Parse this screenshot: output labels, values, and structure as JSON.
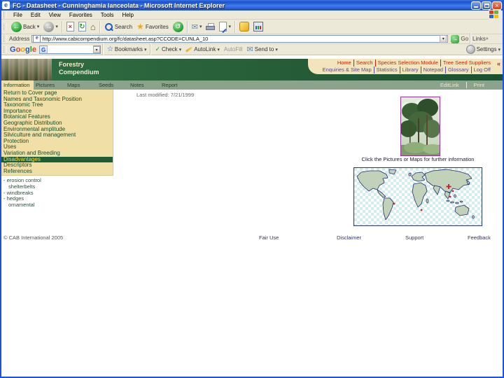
{
  "window": {
    "title": "FC - Datasheet - Cunninghamia lanceolata - Microsoft Internet Explorer"
  },
  "menu": {
    "items": [
      "File",
      "Edit",
      "View",
      "Favorites",
      "Tools",
      "Help"
    ]
  },
  "toolbar": {
    "back": "Back",
    "search": "Search",
    "favorites": "Favorites"
  },
  "address": {
    "label": "Address",
    "url": "http://www.cabicompendium.org/fc/datasheet.asp?CCODE=CUNLA_10",
    "go": "Go",
    "links": "Links"
  },
  "google": {
    "letters": [
      "G",
      "o",
      "o",
      "g",
      "l",
      "e"
    ],
    "search_value": "",
    "bookmarks": "Bookmarks",
    "check": "Check",
    "autolink": "AutoLink",
    "autofill": "AutoFill",
    "sendto": "Send to",
    "settings": "Settings"
  },
  "header": {
    "title1": "Forestry",
    "title2": "Compendium",
    "nav1": [
      "Home",
      "Search",
      "Species Selection Module",
      "Tree Seed Suppliers"
    ],
    "nav2": [
      "Enquiries & Site Map",
      "Statistics",
      "Library",
      "Notepad",
      "Glossary",
      "Log Off"
    ]
  },
  "tabs": {
    "items": [
      "Information",
      "Pictures",
      "Maps",
      "Seeds",
      "Notes",
      "Report"
    ],
    "active": "Information",
    "right1": "EditLink",
    "right2": "Print"
  },
  "sidebar": {
    "items": [
      "Return to Cover page",
      "Names and Taxonomic Position",
      "Taxonomic Tree",
      "Importance",
      "Botanical Features",
      "Geographic Distribution",
      "Environmental amplitude",
      "Silviculture and management",
      "Protection",
      "Uses",
      "Variation and Breeding",
      "Disadvantages",
      "Descriptors",
      "References"
    ],
    "active": "Disadvantages",
    "sub": [
      "- erosion control",
      "shelterbelts",
      "- windbreaks",
      "- hedges",
      "ornamental"
    ]
  },
  "content": {
    "last_modified": "Last modified: 7/21/1999",
    "caption": "Click the Pictures or Maps for further information"
  },
  "footer": {
    "copyright": "© CAB International 2005",
    "links": [
      "Fair Use",
      "Disclaimer",
      "Support",
      "Feedback"
    ]
  },
  "icons": {
    "dropdown": "▾",
    "back_arrow": "←",
    "forward_arrow": "→",
    "stop_x": "×",
    "refresh": "↻",
    "home": "⌂",
    "star": "★",
    "history": "↺",
    "mail": "✉",
    "go_arrow": "→",
    "links_chev": "»",
    "nav_chev": "«",
    "close": "×",
    "ie_e": "e",
    "g_badge": "G",
    "gcheck": "✓",
    "gstar": "☆"
  }
}
